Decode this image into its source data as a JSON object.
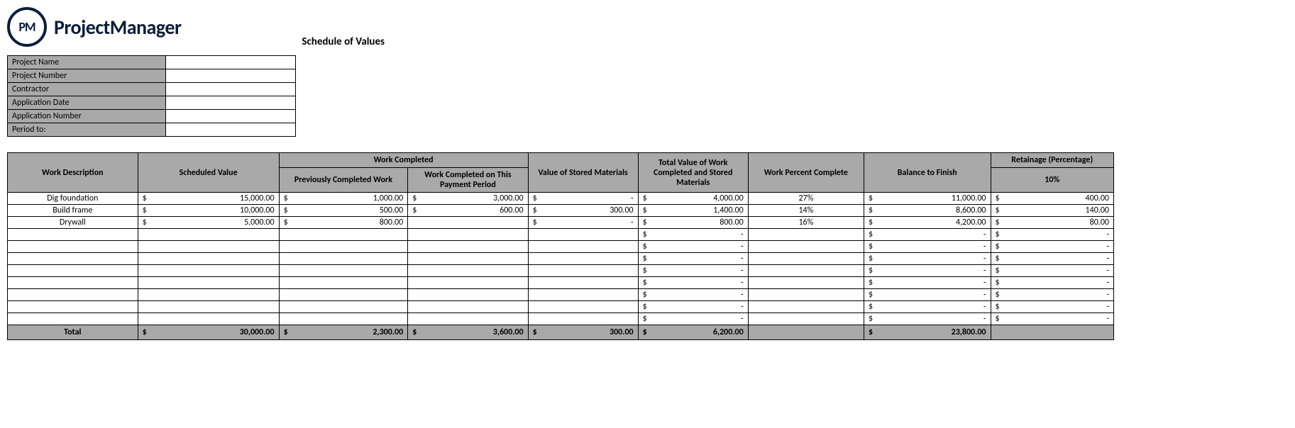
{
  "brand": "ProjectManager",
  "logo_text": "PM",
  "title": "Schedule of Values",
  "info_fields": [
    {
      "label": "Project Name",
      "value": ""
    },
    {
      "label": "Project Number",
      "value": ""
    },
    {
      "label": "Contractor",
      "value": ""
    },
    {
      "label": "Application Date",
      "value": ""
    },
    {
      "label": "Application Number",
      "value": ""
    },
    {
      "label": "Period to:",
      "value": ""
    }
  ],
  "headers": {
    "work_desc": "Work Description",
    "scheduled_value": "Scheduled Value",
    "work_completed_group": "Work Completed",
    "prev_completed": "Previously Completed Work",
    "this_period": "Work Completed on This Payment Period",
    "stored_materials": "Value of Stored Materials",
    "total_value": "Total Value of Work Completed and Stored Materials",
    "percent_complete": "Work Percent Complete",
    "balance": "Balance to Finish",
    "retainage_group": "Retainage (Percentage)",
    "retainage_pct": "10%"
  },
  "rows": [
    {
      "desc": "Dig foundation",
      "sched": "15,000.00",
      "prev": "1,000.00",
      "curr": "3,000.00",
      "stored": "-",
      "total": "4,000.00",
      "pct": "27%",
      "bal": "11,000.00",
      "ret": "400.00"
    },
    {
      "desc": "Build frame",
      "sched": "10,000.00",
      "prev": "500.00",
      "curr": "600.00",
      "stored": "300.00",
      "total": "1,400.00",
      "pct": "14%",
      "bal": "8,600.00",
      "ret": "140.00"
    },
    {
      "desc": "Drywall",
      "sched": "5,000.00",
      "prev": "800.00",
      "curr": "",
      "stored": "-",
      "total": "800.00",
      "pct": "16%",
      "bal": "4,200.00",
      "ret": "80.00"
    },
    {
      "desc": "",
      "sched": "",
      "prev": "",
      "curr": "",
      "stored": "",
      "total": "-",
      "pct": "",
      "bal": "-",
      "ret": "-"
    },
    {
      "desc": "",
      "sched": "",
      "prev": "",
      "curr": "",
      "stored": "",
      "total": "-",
      "pct": "",
      "bal": "-",
      "ret": "-"
    },
    {
      "desc": "",
      "sched": "",
      "prev": "",
      "curr": "",
      "stored": "",
      "total": "-",
      "pct": "",
      "bal": "-",
      "ret": "-"
    },
    {
      "desc": "",
      "sched": "",
      "prev": "",
      "curr": "",
      "stored": "",
      "total": "-",
      "pct": "",
      "bal": "-",
      "ret": "-"
    },
    {
      "desc": "",
      "sched": "",
      "prev": "",
      "curr": "",
      "stored": "",
      "total": "-",
      "pct": "",
      "bal": "-",
      "ret": "-"
    },
    {
      "desc": "",
      "sched": "",
      "prev": "",
      "curr": "",
      "stored": "",
      "total": "-",
      "pct": "",
      "bal": "-",
      "ret": "-"
    },
    {
      "desc": "",
      "sched": "",
      "prev": "",
      "curr": "",
      "stored": "",
      "total": "-",
      "pct": "",
      "bal": "-",
      "ret": "-"
    },
    {
      "desc": "",
      "sched": "",
      "prev": "",
      "curr": "",
      "stored": "",
      "total": "-",
      "pct": "",
      "bal": "-",
      "ret": "-"
    }
  ],
  "totals": {
    "label": "Total",
    "sched": "30,000.00",
    "prev": "2,300.00",
    "curr": "3,600.00",
    "stored": "300.00",
    "total": "6,200.00",
    "pct": "",
    "bal": "23,800.00",
    "ret": ""
  }
}
